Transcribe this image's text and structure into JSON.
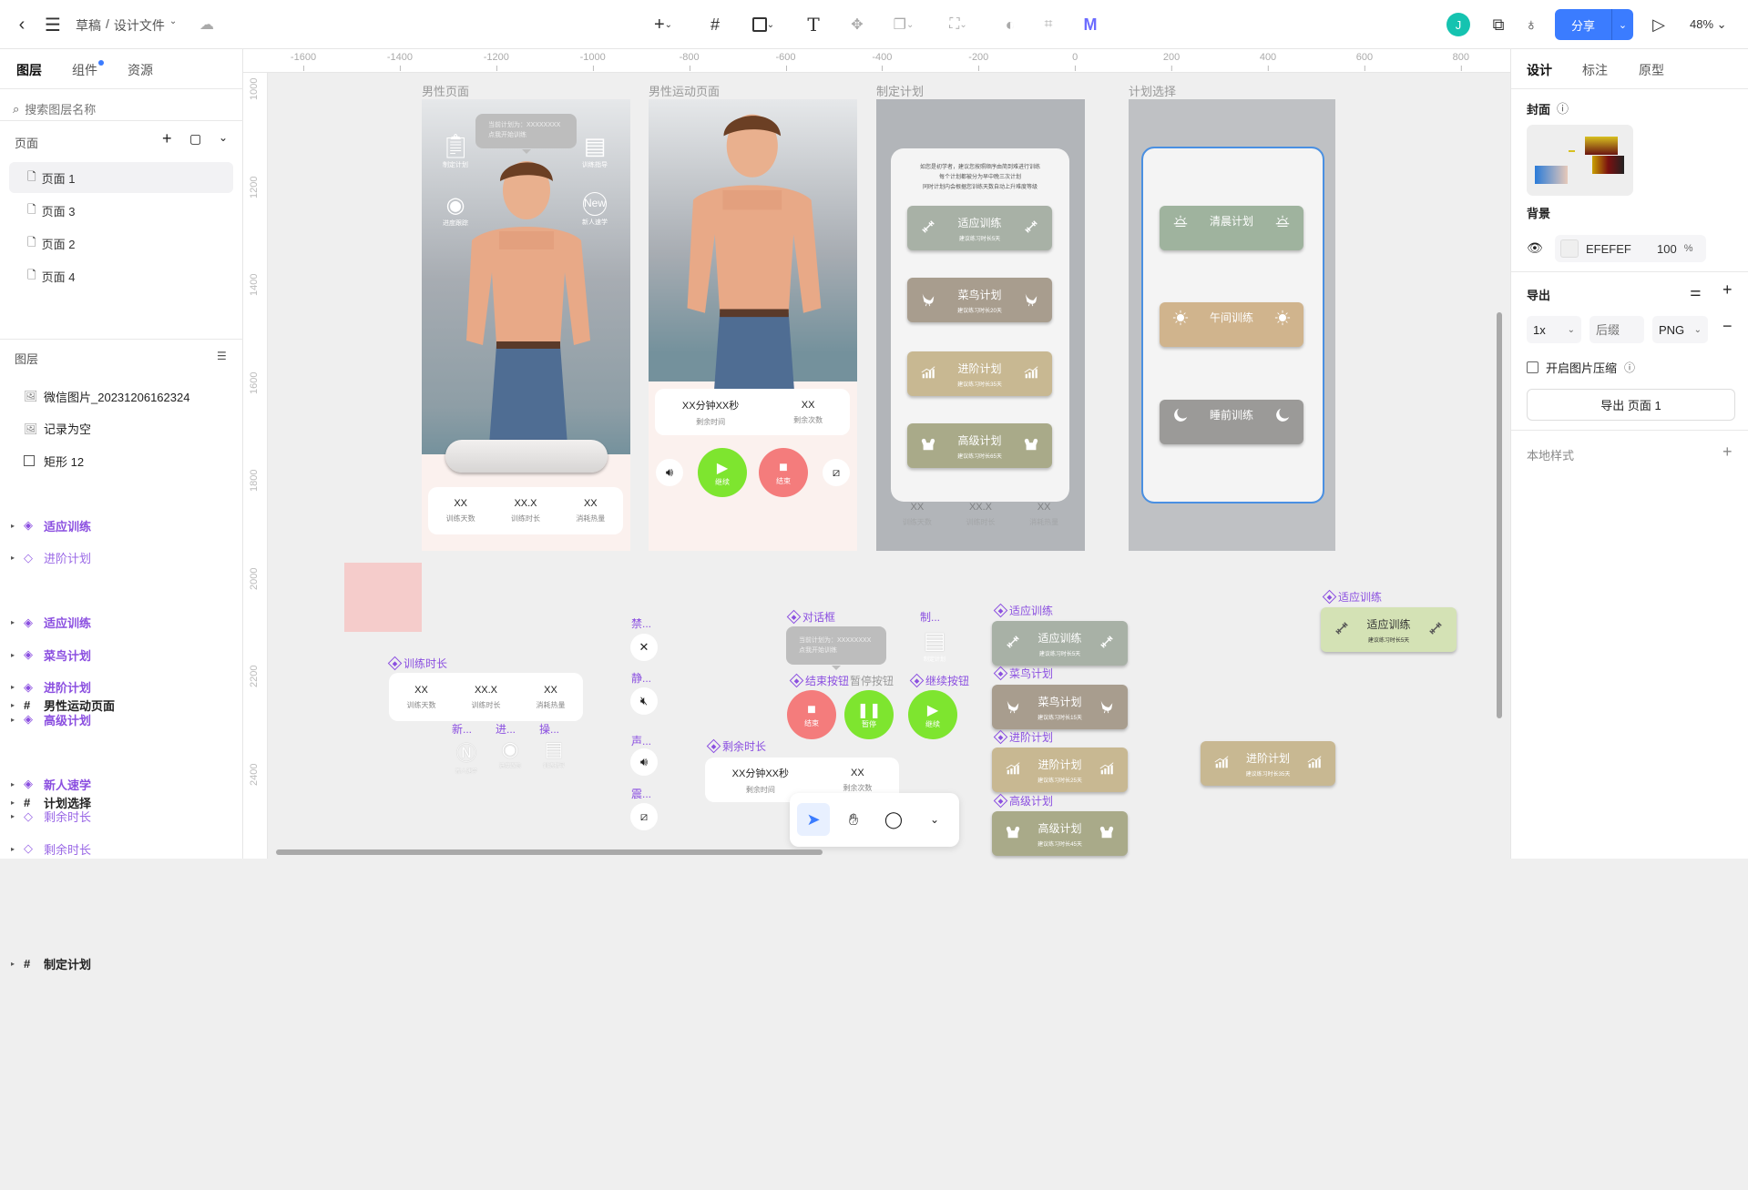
{
  "header": {
    "breadcrumb_root": "草稿",
    "breadcrumb_sep": "/",
    "file_name": "设计文件",
    "avatar": "J",
    "share": "分享",
    "zoom": "48%"
  },
  "left": {
    "tabs": [
      "图层",
      "组件",
      "资源"
    ],
    "search_placeholder": "搜索图层名称",
    "pages_title": "页面",
    "pages": [
      "页面 1",
      "页面 3",
      "页面 2",
      "页面 4"
    ],
    "layers_title": "图层",
    "layers": [
      {
        "label": "微信图片_20231206162324",
        "kind": "image"
      },
      {
        "label": "记录为空",
        "kind": "image"
      },
      {
        "label": "矩形 12",
        "kind": "rect"
      },
      {
        "label": "男性运动页面",
        "kind": "frame"
      },
      {
        "label": "适应训练",
        "kind": "comp"
      },
      {
        "label": "进阶计划",
        "kind": "inst"
      },
      {
        "label": "计划选择",
        "kind": "frame"
      },
      {
        "label": "适应训练",
        "kind": "comp"
      },
      {
        "label": "菜鸟计划",
        "kind": "comp"
      },
      {
        "label": "进阶计划",
        "kind": "comp"
      },
      {
        "label": "高级计划",
        "kind": "comp"
      },
      {
        "label": "制定计划",
        "kind": "frame"
      },
      {
        "label": "新人速学",
        "kind": "comp"
      },
      {
        "label": "剩余时长",
        "kind": "inst"
      },
      {
        "label": "剩余时长",
        "kind": "inst"
      }
    ]
  },
  "rulers": {
    "x": [
      "-1600",
      "-1400",
      "-1200",
      "-1000",
      "-800",
      "-600",
      "-400",
      "-200",
      "0",
      "200",
      "400",
      "600",
      "800"
    ],
    "y": [
      "1000",
      "1200",
      "1400",
      "1600",
      "1800",
      "2000",
      "2200",
      "2400"
    ]
  },
  "canvas": {
    "male_page": {
      "title": "男性页面",
      "bubble": [
        "当前计划为：XXXXXXXX",
        "点我开始训练"
      ],
      "icons": [
        "制定计划",
        "训练指导",
        "进度跟踪",
        "新人速学"
      ],
      "stats": [
        {
          "value": "XX",
          "label": "训练天数"
        },
        {
          "value": "XX.X",
          "label": "训练时长"
        },
        {
          "value": "XX",
          "label": "消耗热量"
        }
      ]
    },
    "sport_page": {
      "title": "男性运动页面",
      "stats": [
        {
          "value": "XX分钟XX秒",
          "label": "剩余时间"
        },
        {
          "value": "XX",
          "label": "剩余次数"
        }
      ],
      "play": "继续",
      "stop": "结束"
    },
    "plan_make": {
      "title": "制定计划",
      "intro": [
        "如您是初学者，建议您按照顺序由简到难进行训练",
        "每个计划都被分为早中晚三次计划",
        "同时计划内会根据您训练天数自动上升难度等级"
      ],
      "cards": [
        {
          "title": "适应训练",
          "sub": "建议练习时长5天",
          "color": "#a8b1a6",
          "icon": "dumbbell"
        },
        {
          "title": "菜鸟计划",
          "sub": "建议练习时长20天",
          "color": "#a89d8e",
          "icon": "bird"
        },
        {
          "title": "进阶计划",
          "sub": "建议练习时长35天",
          "color": "#c8b892",
          "icon": "chart"
        },
        {
          "title": "高级计划",
          "sub": "建议练习时长65天",
          "color": "#a9aa89",
          "icon": "muscle"
        }
      ],
      "faded_stats": [
        {
          "value": "XX",
          "label": "训练天数"
        },
        {
          "value": "XX.X",
          "label": "训练时长"
        },
        {
          "value": "XX",
          "label": "消耗热量"
        }
      ]
    },
    "plan_select": {
      "title": "计划选择",
      "cards": [
        {
          "title": "清晨计划",
          "sub": "",
          "color": "#9fb39e",
          "icon": "sunrise"
        },
        {
          "title": "午间训练",
          "sub": "",
          "color": "#d0b48d",
          "icon": "sun"
        },
        {
          "title": "睡前训练",
          "sub": "",
          "color": "#9b9a98",
          "icon": "moon"
        }
      ]
    },
    "components": {
      "train_time": {
        "label": "训练时长",
        "stats": [
          {
            "value": "XX",
            "label": "训练天数"
          },
          {
            "value": "XX.X",
            "label": "训练时长"
          },
          {
            "value": "XX",
            "label": "消耗热量"
          }
        ]
      },
      "small_icons": [
        {
          "label": "新...",
          "caption": "新人速学"
        },
        {
          "label": "进...",
          "caption": "进度跟踪"
        },
        {
          "label": "操...",
          "caption": "训练指导"
        }
      ],
      "sound_icons": [
        {
          "label": "禁...",
          "icon": "mute-cross"
        },
        {
          "label": "静...",
          "icon": "mute"
        },
        {
          "label": "声...",
          "icon": "speaker"
        },
        {
          "label": "震...",
          "icon": "vibrate"
        }
      ],
      "dialog": {
        "label": "对话框",
        "lines": [
          "当前计划为：XXXXXXXX",
          "点我开始训练"
        ]
      },
      "make_plan": {
        "label": "制...",
        "caption": "制定计划"
      },
      "end_btn": {
        "label": "结束按钮",
        "text": "结束"
      },
      "pause_btn": {
        "label": "暂停按钮",
        "text": "暂停"
      },
      "continue_btn": {
        "label": "继续按钮",
        "text": "继续"
      },
      "remain": {
        "label": "剩余时长",
        "stats": [
          {
            "value": "XX分钟XX秒",
            "label": "剩余时间"
          },
          {
            "value": "XX",
            "label": "剩余次数"
          }
        ]
      },
      "plan_column": [
        {
          "title": "适应训练",
          "sub": "建议练习时长5天",
          "color": "#a8b1a6",
          "icon": "dumbbell"
        },
        {
          "title": "菜鸟计划",
          "sub": "建议练习时长15天",
          "color": "#a89d8e",
          "icon": "bird"
        },
        {
          "title": "进阶计划",
          "sub": "建议练习时长25天",
          "color": "#c8b892",
          "icon": "chart"
        },
        {
          "title": "高级计划",
          "sub": "建议练习时长45天",
          "color": "#a9aa89",
          "icon": "muscle"
        }
      ],
      "plan_single": {
        "title": "进阶计划",
        "sub": "建议练习时长35天",
        "color": "#c8b892",
        "icon": "chart"
      },
      "plan_green": {
        "label": "适应训练",
        "title": "适应训练",
        "sub": "建议练习时长5天",
        "color": "#d4e2b5",
        "icon": "dumbbell"
      }
    }
  },
  "right": {
    "tabs": [
      "设计",
      "标注",
      "原型"
    ],
    "cover_title": "封面",
    "bg_title": "背景",
    "bg_hex": "EFEFEF",
    "bg_opacity": "100",
    "bg_pct": "%",
    "export_title": "导出",
    "scale": "1x",
    "suffix_placeholder": "后缀",
    "format": "PNG",
    "compress": "开启图片压缩",
    "export_btn": "导出 页面 1",
    "local_styles": "本地样式"
  },
  "colors": {
    "accent": "#3b7cff",
    "component": "#8b4fe0",
    "green_btn": "#7ee52f",
    "red_btn": "#f47c7c"
  }
}
